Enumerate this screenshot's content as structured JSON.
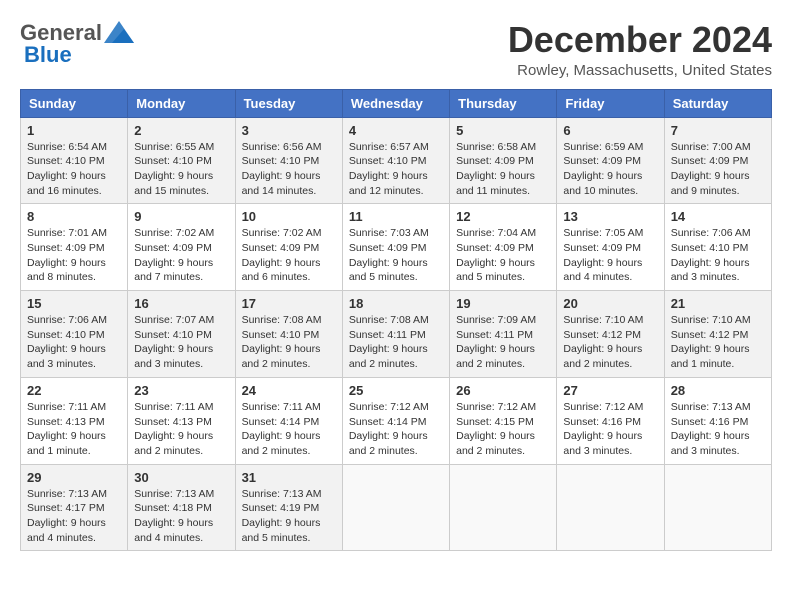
{
  "header": {
    "logo_general": "General",
    "logo_blue": "Blue",
    "month_title": "December 2024",
    "location": "Rowley, Massachusetts, United States"
  },
  "days_of_week": [
    "Sunday",
    "Monday",
    "Tuesday",
    "Wednesday",
    "Thursday",
    "Friday",
    "Saturday"
  ],
  "weeks": [
    [
      {
        "day": "1",
        "info": "Sunrise: 6:54 AM\nSunset: 4:10 PM\nDaylight: 9 hours and 16 minutes."
      },
      {
        "day": "2",
        "info": "Sunrise: 6:55 AM\nSunset: 4:10 PM\nDaylight: 9 hours and 15 minutes."
      },
      {
        "day": "3",
        "info": "Sunrise: 6:56 AM\nSunset: 4:10 PM\nDaylight: 9 hours and 14 minutes."
      },
      {
        "day": "4",
        "info": "Sunrise: 6:57 AM\nSunset: 4:10 PM\nDaylight: 9 hours and 12 minutes."
      },
      {
        "day": "5",
        "info": "Sunrise: 6:58 AM\nSunset: 4:09 PM\nDaylight: 9 hours and 11 minutes."
      },
      {
        "day": "6",
        "info": "Sunrise: 6:59 AM\nSunset: 4:09 PM\nDaylight: 9 hours and 10 minutes."
      },
      {
        "day": "7",
        "info": "Sunrise: 7:00 AM\nSunset: 4:09 PM\nDaylight: 9 hours and 9 minutes."
      }
    ],
    [
      {
        "day": "8",
        "info": "Sunrise: 7:01 AM\nSunset: 4:09 PM\nDaylight: 9 hours and 8 minutes."
      },
      {
        "day": "9",
        "info": "Sunrise: 7:02 AM\nSunset: 4:09 PM\nDaylight: 9 hours and 7 minutes."
      },
      {
        "day": "10",
        "info": "Sunrise: 7:02 AM\nSunset: 4:09 PM\nDaylight: 9 hours and 6 minutes."
      },
      {
        "day": "11",
        "info": "Sunrise: 7:03 AM\nSunset: 4:09 PM\nDaylight: 9 hours and 5 minutes."
      },
      {
        "day": "12",
        "info": "Sunrise: 7:04 AM\nSunset: 4:09 PM\nDaylight: 9 hours and 5 minutes."
      },
      {
        "day": "13",
        "info": "Sunrise: 7:05 AM\nSunset: 4:09 PM\nDaylight: 9 hours and 4 minutes."
      },
      {
        "day": "14",
        "info": "Sunrise: 7:06 AM\nSunset: 4:10 PM\nDaylight: 9 hours and 3 minutes."
      }
    ],
    [
      {
        "day": "15",
        "info": "Sunrise: 7:06 AM\nSunset: 4:10 PM\nDaylight: 9 hours and 3 minutes."
      },
      {
        "day": "16",
        "info": "Sunrise: 7:07 AM\nSunset: 4:10 PM\nDaylight: 9 hours and 3 minutes."
      },
      {
        "day": "17",
        "info": "Sunrise: 7:08 AM\nSunset: 4:10 PM\nDaylight: 9 hours and 2 minutes."
      },
      {
        "day": "18",
        "info": "Sunrise: 7:08 AM\nSunset: 4:11 PM\nDaylight: 9 hours and 2 minutes."
      },
      {
        "day": "19",
        "info": "Sunrise: 7:09 AM\nSunset: 4:11 PM\nDaylight: 9 hours and 2 minutes."
      },
      {
        "day": "20",
        "info": "Sunrise: 7:10 AM\nSunset: 4:12 PM\nDaylight: 9 hours and 2 minutes."
      },
      {
        "day": "21",
        "info": "Sunrise: 7:10 AM\nSunset: 4:12 PM\nDaylight: 9 hours and 1 minute."
      }
    ],
    [
      {
        "day": "22",
        "info": "Sunrise: 7:11 AM\nSunset: 4:13 PM\nDaylight: 9 hours and 1 minute."
      },
      {
        "day": "23",
        "info": "Sunrise: 7:11 AM\nSunset: 4:13 PM\nDaylight: 9 hours and 2 minutes."
      },
      {
        "day": "24",
        "info": "Sunrise: 7:11 AM\nSunset: 4:14 PM\nDaylight: 9 hours and 2 minutes."
      },
      {
        "day": "25",
        "info": "Sunrise: 7:12 AM\nSunset: 4:14 PM\nDaylight: 9 hours and 2 minutes."
      },
      {
        "day": "26",
        "info": "Sunrise: 7:12 AM\nSunset: 4:15 PM\nDaylight: 9 hours and 2 minutes."
      },
      {
        "day": "27",
        "info": "Sunrise: 7:12 AM\nSunset: 4:16 PM\nDaylight: 9 hours and 3 minutes."
      },
      {
        "day": "28",
        "info": "Sunrise: 7:13 AM\nSunset: 4:16 PM\nDaylight: 9 hours and 3 minutes."
      }
    ],
    [
      {
        "day": "29",
        "info": "Sunrise: 7:13 AM\nSunset: 4:17 PM\nDaylight: 9 hours and 4 minutes."
      },
      {
        "day": "30",
        "info": "Sunrise: 7:13 AM\nSunset: 4:18 PM\nDaylight: 9 hours and 4 minutes."
      },
      {
        "day": "31",
        "info": "Sunrise: 7:13 AM\nSunset: 4:19 PM\nDaylight: 9 hours and 5 minutes."
      },
      null,
      null,
      null,
      null
    ]
  ]
}
